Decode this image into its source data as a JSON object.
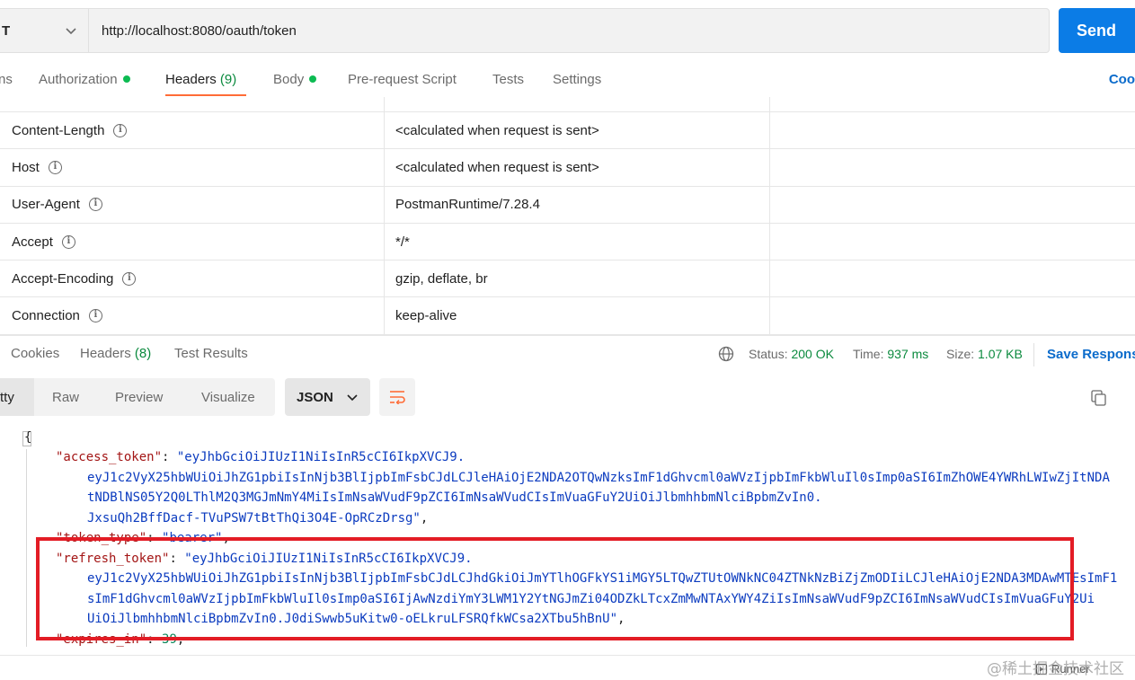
{
  "request": {
    "method": "T",
    "url": "http://localhost:8080/oauth/token",
    "send_label": "Send"
  },
  "req_tabs": {
    "params": "ns",
    "authorization": "Authorization",
    "headers": "Headers",
    "headers_count": "(9)",
    "body": "Body",
    "prerequest": "Pre-request Script",
    "tests": "Tests",
    "settings": "Settings",
    "cookies": "Coo"
  },
  "headers": [
    {
      "key": "Content-Length",
      "value": "<calculated when request is sent>"
    },
    {
      "key": "Host",
      "value": "<calculated when request is sent>"
    },
    {
      "key": "User-Agent",
      "value": "PostmanRuntime/7.28.4"
    },
    {
      "key": "Accept",
      "value": "*/*"
    },
    {
      "key": "Accept-Encoding",
      "value": "gzip, deflate, br"
    },
    {
      "key": "Connection",
      "value": "keep-alive"
    }
  ],
  "response": {
    "tabs": {
      "cookies": "Cookies",
      "headers": "Headers",
      "headers_count": "(8)",
      "test_results": "Test Results"
    },
    "status_label": "Status:",
    "status_value": "200 OK",
    "time_label": "Time:",
    "time_value": "937 ms",
    "size_label": "Size:",
    "size_value": "1.07 KB",
    "save_label": "Save Respons"
  },
  "view": {
    "pretty": "tty",
    "raw": "Raw",
    "preview": "Preview",
    "visualize": "Visualize",
    "format": "JSON"
  },
  "code": {
    "open_brace": "{",
    "access_token_key": "\"access_token\"",
    "access_token_lines": [
      "\"eyJhbGciOiJIUzI1NiIsInR5cCI6IkpXVCJ9.",
      "eyJ1c2VyX25hbWUiOiJhZG1pbiIsInNjb3BlIjpbImFsbCJdLCJleHAiOjE2NDA2OTQwNzksImF1dGhvcml0aWVzIjpbImFkbWluIl0sImp0aSI6ImZhOWE4YWRhLWIwZjItNDA",
      "tNDBlNS05Y2Q0LThlM2Q3MGJmNmY4MiIsImNsaWVudF9pZCI6ImNsaWVudCIsImVuaGFuY2UiOiJlbmhhbmNlciBpbmZvIn0.",
      "JxsuQh2BffDacf-TVuPSW7tBtThQi3O4E-OpRCzDrsg\""
    ],
    "token_type_key": "\"token_type\"",
    "token_type_value": "\"bearer\"",
    "refresh_token_key": "\"refresh_token\"",
    "refresh_token_lines": [
      "\"eyJhbGciOiJIUzI1NiIsInR5cCI6IkpXVCJ9.",
      "eyJ1c2VyX25hbWUiOiJhZG1pbiIsInNjb3BlIjpbImFsbCJdLCJhdGkiOiJmYTlhOGFkYS1iMGY5LTQwZTUtOWNkNC04ZTNkNzBiZjZmODIiLCJleHAiOjE2NDA3MDAwMTEsImF1",
      "sImF1dGhvcml0aWVzIjpbImFkbWluIl0sImp0aSI6IjAwNzdiYmY3LWM1Y2YtNGJmZi04ODZkLTcxZmMwNTAxYWY4ZiIsImNsaWVudF9pZCI6ImNsaWVudCIsImVuaGFuY2Ui",
      "UiOiJlbmhhbmNlciBpbmZvIn0.J0diSwwb5uKitw0-oELkruLFSRQfkWCsa2XTbu5hBnU\""
    ],
    "expires_key": "\"expires_in\"",
    "expires_value": "39"
  },
  "footer": {
    "runner": "Runner",
    "watermark": "@稀土掘金技术社区"
  },
  "colors": {
    "accent": "#ff6c37",
    "send": "#0b7ce6",
    "success": "#0cbb52",
    "highlight": "#e31c25"
  }
}
